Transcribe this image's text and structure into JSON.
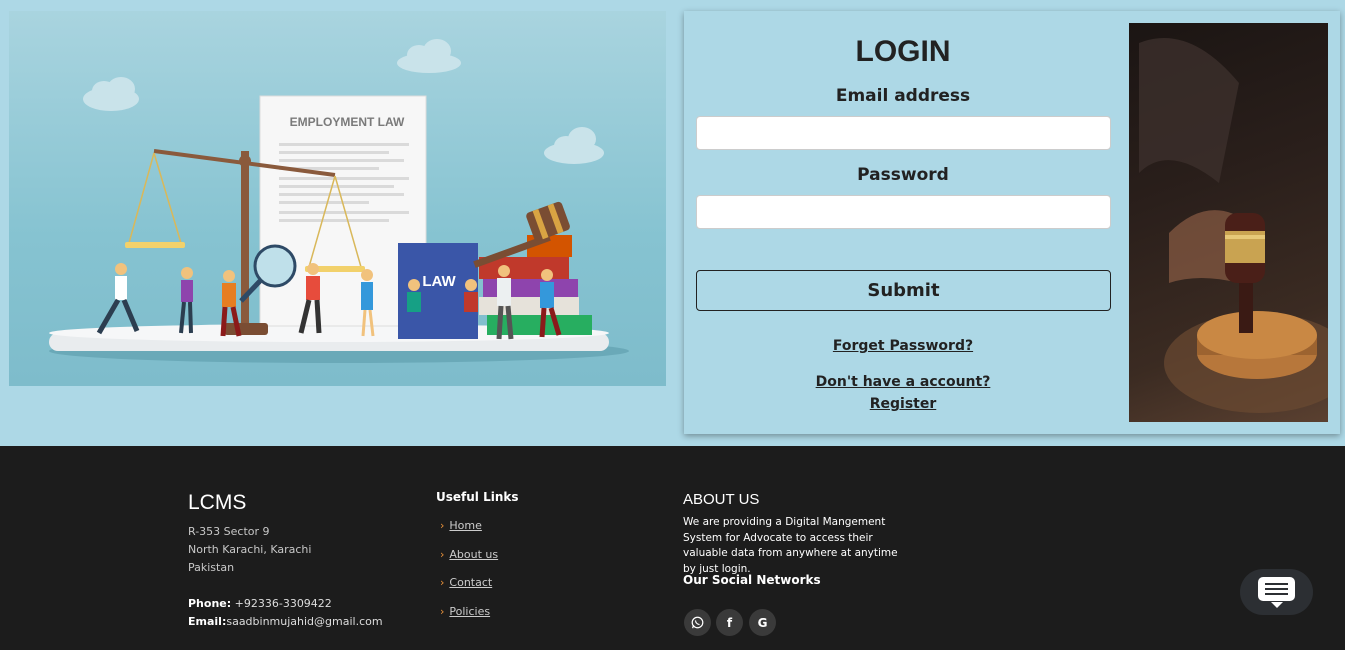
{
  "hero": {
    "document_title": "EMPLOYMENT LAW",
    "book_label": "LAW"
  },
  "login": {
    "title": "LOGIN",
    "email_label": "Email address",
    "email_value": "",
    "password_label": "Password",
    "password_value": "",
    "submit_label": "Submit",
    "forgot_label": "Forget Password?",
    "no_account_label": "Don't have a account?",
    "register_label": "Register"
  },
  "footer": {
    "brand": "LCMS",
    "address": [
      "R-353 Sector 9",
      "North Karachi, Karachi",
      "Pakistan"
    ],
    "phone_label": "Phone:",
    "phone_value": " +92336-3309422",
    "email_label": "Email:",
    "email_value": "saadbinmujahid@gmail.com",
    "useful_links_title": "Useful Links",
    "links": [
      "Home",
      "About us",
      "Contact",
      "Policies"
    ],
    "about_title": "ABOUT US",
    "about_text": "We are providing a Digital Mangement System for Advocate to access their valuable data from anywhere at anytime by just login.",
    "social_title": "Our Social Networks",
    "social_icons": [
      "whatsapp-icon",
      "facebook-icon",
      "google-icon"
    ]
  },
  "colors": {
    "page_bg": "#add8e6",
    "footer_bg": "#1c1c1c",
    "link_chevron": "#e8913a"
  }
}
